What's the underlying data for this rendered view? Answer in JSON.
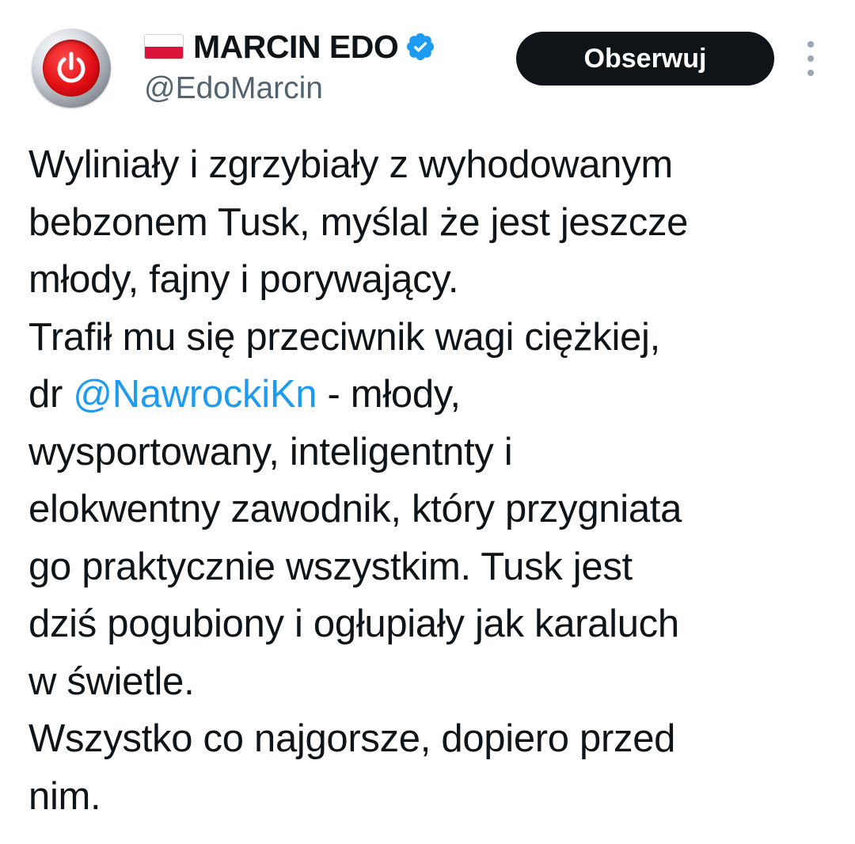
{
  "author": {
    "display_name": "MARCIN EDO",
    "handle": "@EdoMarcin",
    "flag_icon": "poland-flag-icon",
    "verified_icon": "verified-badge-icon",
    "verified_color": "#1d9bf0",
    "avatar_icon": "power-button-icon"
  },
  "actions": {
    "follow_label": "Obserwuj",
    "more_icon": "more-options-icon"
  },
  "tweet": {
    "line1": "Wyliniały i zgrzybiały z wyhodowanym",
    "line2": "bebzonem Tusk, myślal że jest jeszcze",
    "line3": "młody, fajny i porywający.",
    "line4": "Trafił mu się przeciwnik wagi ciężkiej,",
    "line5_prefix": "dr ",
    "line5_mention": "@NawrockiKn",
    "line5_suffix": " - młody,",
    "line6": "wysportowany, inteligentnty i",
    "line7": "elokwentny zawodnik, który przygniata",
    "line8": "go praktycznie wszystkim. Tusk jest",
    "line9": "dziś pogubiony i ogłupiały jak karaluch",
    "line10": "w świetle.",
    "line11": "Wszystko co najgorsze, dopiero przed",
    "line12": "nim."
  },
  "colors": {
    "text": "#0f1419",
    "secondary": "#536471",
    "link": "#1d9bf0",
    "button_bg": "#0f1419",
    "button_text": "#ffffff"
  }
}
